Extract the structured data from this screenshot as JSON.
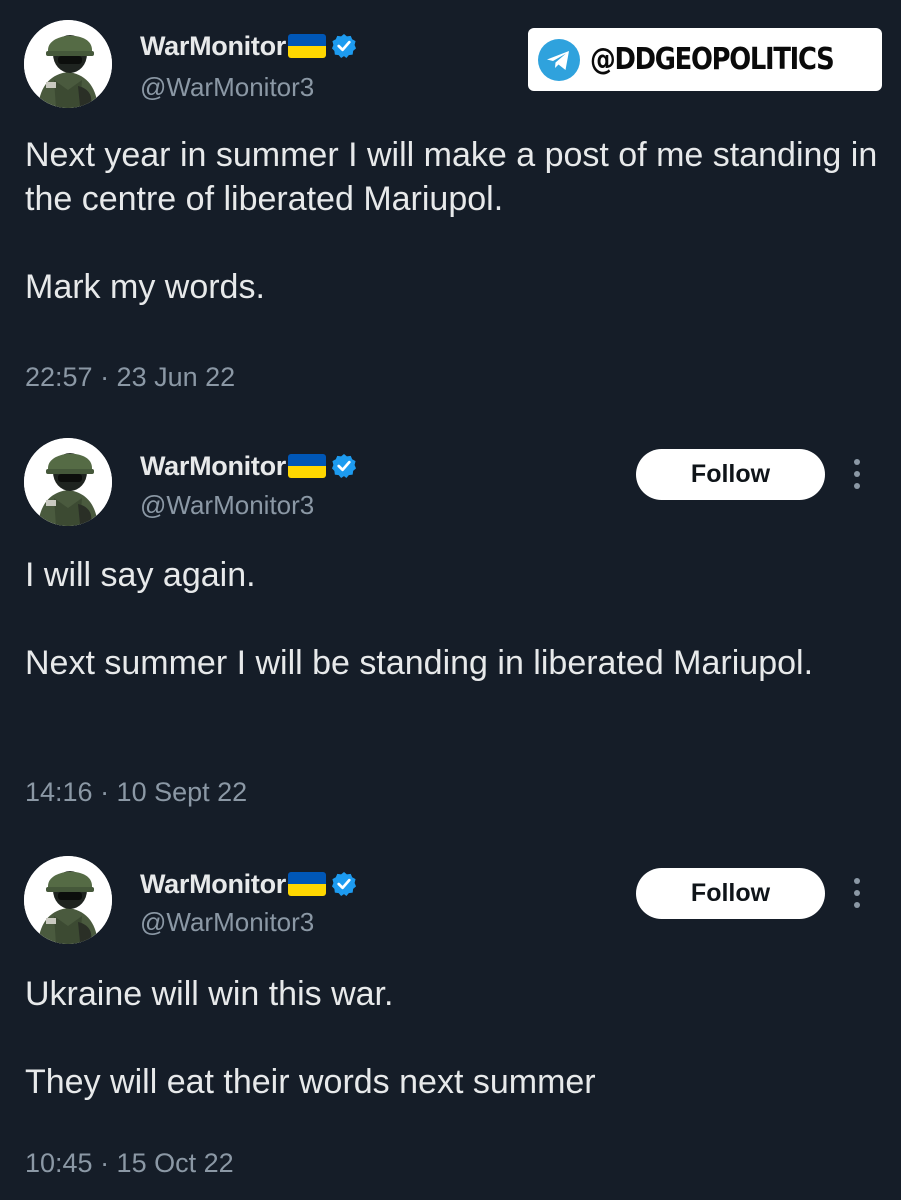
{
  "watermark": {
    "text": "@DDGEOPOLITICS",
    "icon": "telegram-icon",
    "icon_color": "#2fa2dd"
  },
  "colors": {
    "background": "#151d28",
    "primary_text": "#e7e9ea",
    "secondary_text": "#8b98a5",
    "verified_badge": "#1d9bf0",
    "flag_blue": "#0057b7",
    "flag_yellow": "#ffd700"
  },
  "tweets": [
    {
      "display_name": "WarMonitor",
      "handle": "@WarMonitor3",
      "flag": "ukraine-flag-emoji",
      "verified": true,
      "text": "Next year in summer I will make a post of me standing in the centre of liberated Mariupol.\n\nMark my words.",
      "meta": "22:57 · 23 Jun 22",
      "show_follow": false
    },
    {
      "display_name": "WarMonitor",
      "handle": "@WarMonitor3",
      "flag": "ukraine-flag-emoji",
      "verified": true,
      "follow_label": "Follow",
      "text": "I will say again.\n\nNext summer I will be standing in liberated Mariupol.",
      "meta": "14:16 · 10 Sept 22",
      "show_follow": true
    },
    {
      "display_name": "WarMonitor",
      "handle": "@WarMonitor3",
      "flag": "ukraine-flag-emoji",
      "verified": true,
      "follow_label": "Follow",
      "text": "Ukraine will win this war.\n\nThey will eat their words next summer",
      "meta": "10:45 · 15 Oct 22",
      "show_follow": true
    }
  ]
}
